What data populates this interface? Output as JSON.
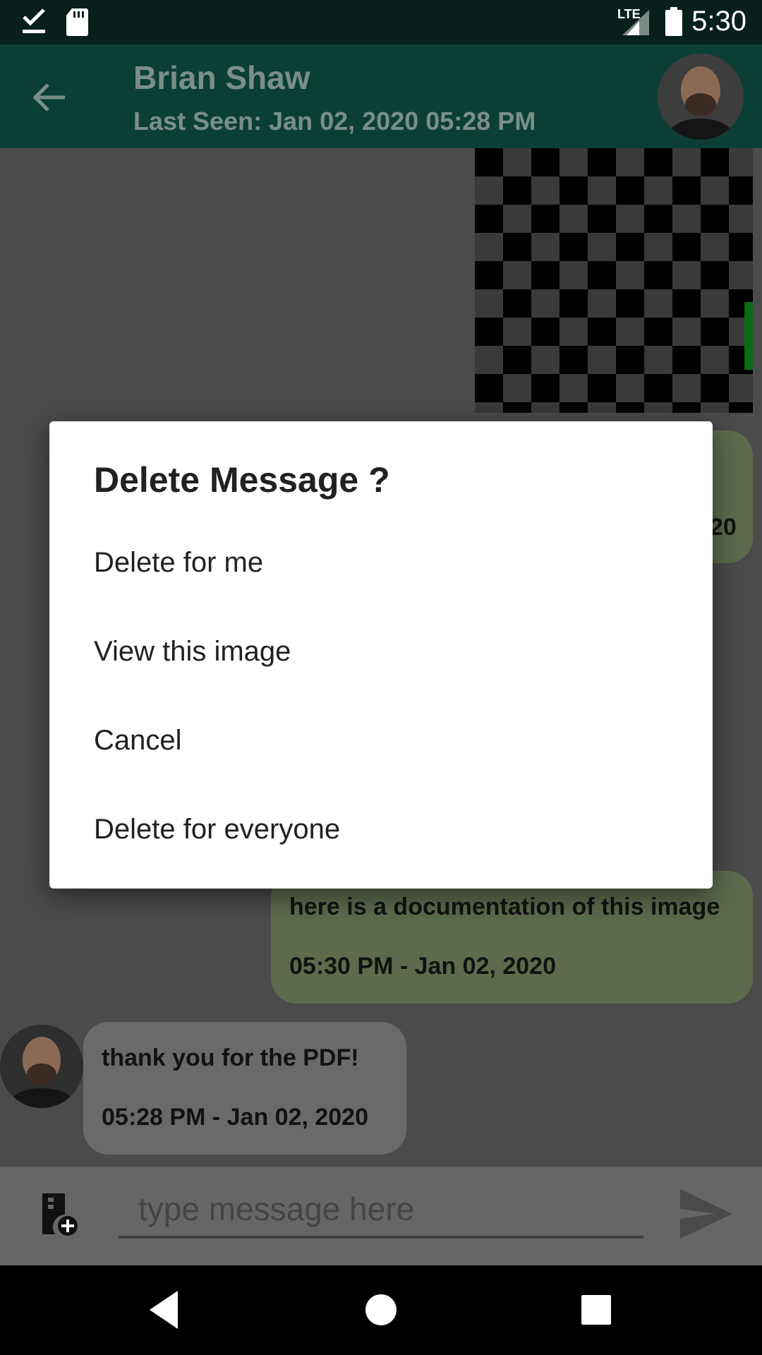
{
  "status_bar": {
    "time": "5:30",
    "network": "LTE",
    "icons": [
      "check-download-icon",
      "sd-card-icon",
      "signal-icon",
      "battery-icon"
    ]
  },
  "header": {
    "contact_name": "Brian Shaw",
    "last_seen": "Last Seen: Jan 02, 2020 05:28 PM",
    "back_icon": "arrow-back-icon"
  },
  "messages": {
    "partial_sent": {
      "time_tail": "20"
    },
    "sent_doc": {
      "text": "here is a documentation of this image",
      "time": "05:30 PM - Jan 02, 2020"
    },
    "received": {
      "text": "thank you for the PDF!",
      "time": "05:28 PM - Jan 02, 2020"
    }
  },
  "composer": {
    "placeholder": "type message here",
    "attach_icon": "attach-file-icon",
    "send_icon": "send-icon"
  },
  "dialog": {
    "title": "Delete Message ?",
    "options": [
      "Delete for me",
      "View this image",
      "Cancel",
      "Delete for everyone"
    ]
  },
  "colors": {
    "app_bar": "#0b3f36",
    "status_bar": "#08201c",
    "sent_bubble": "#5d6b4c",
    "received_bubble": "#6a6a6a"
  }
}
